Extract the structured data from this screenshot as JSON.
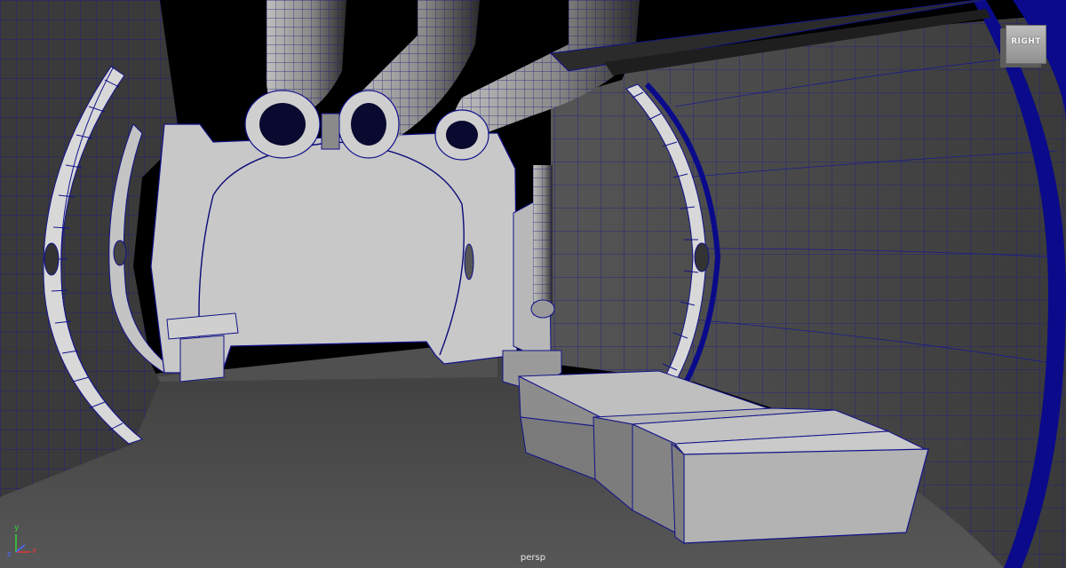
{
  "viewport": {
    "camera_label": "persp"
  },
  "view_cube": {
    "face_label": "RIGHT"
  },
  "axis_gizmo": {
    "x_label": "x",
    "y_label": "y",
    "z_label": "z",
    "x_color": "#e03a3a",
    "y_color": "#3ad23a",
    "z_color": "#4a6bff"
  },
  "colors": {
    "background": "#000000",
    "wireframe": "#12128a",
    "ring_highlight": "#0a0a8a",
    "surface_light": "#c8c8c8",
    "surface_mid": "#9a9a9a",
    "floor": "#4d4d4d"
  }
}
